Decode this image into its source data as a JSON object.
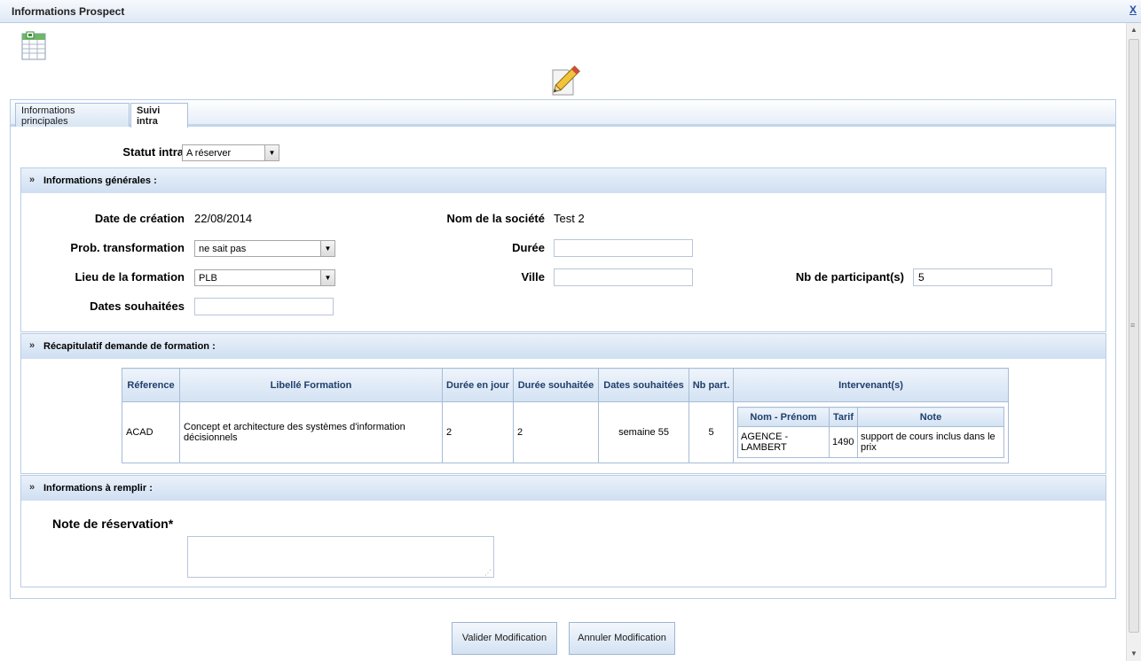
{
  "window": {
    "title": "Informations Prospect",
    "close_label": "X"
  },
  "tabs": [
    {
      "label": "Informations principales"
    },
    {
      "label": "Suivi intra"
    }
  ],
  "statut": {
    "label": "Statut intra",
    "value": "A réserver"
  },
  "general": {
    "title": "Informations générales :",
    "date_creation_label": "Date de création",
    "date_creation_value": "22/08/2014",
    "societe_label": "Nom de la société",
    "societe_value": "Test 2",
    "prob_label": "Prob. transformation",
    "prob_value": "ne sait pas",
    "duree_label": "Durée",
    "duree_value": "",
    "lieu_label": "Lieu de la formation",
    "lieu_value": "PLB",
    "ville_label": "Ville",
    "ville_value": "",
    "nb_label": "Nb de participant(s)",
    "nb_value": "5",
    "dates_label": "Dates souhaitées",
    "dates_value": ""
  },
  "recap": {
    "title": "Récapitulatif demande de formation :",
    "headers": [
      "Réference",
      "Libellé Formation",
      "Durée en jour",
      "Durée souhaitée",
      "Dates souhaitées",
      "Nb part.",
      "Intervenant(s)"
    ],
    "row": {
      "reference": "ACAD",
      "libelle": "Concept et architecture des systèmes d'information décisionnels",
      "duree_jour": "2",
      "duree_souhaitee": "2",
      "dates": "semaine 55",
      "nb": "5"
    },
    "intervenant_headers": [
      "Nom - Prénom",
      "Tarif",
      "Note"
    ],
    "intervenant": {
      "nom": "AGENCE - LAMBERT",
      "tarif": "1490",
      "note": "support de cours inclus dans le prix"
    }
  },
  "remplir": {
    "title": "Informations à remplir :",
    "note_label": "Note de réservation*",
    "note_value": ""
  },
  "buttons": {
    "valider": "Valider Modification",
    "annuler": "Annuler Modification"
  }
}
